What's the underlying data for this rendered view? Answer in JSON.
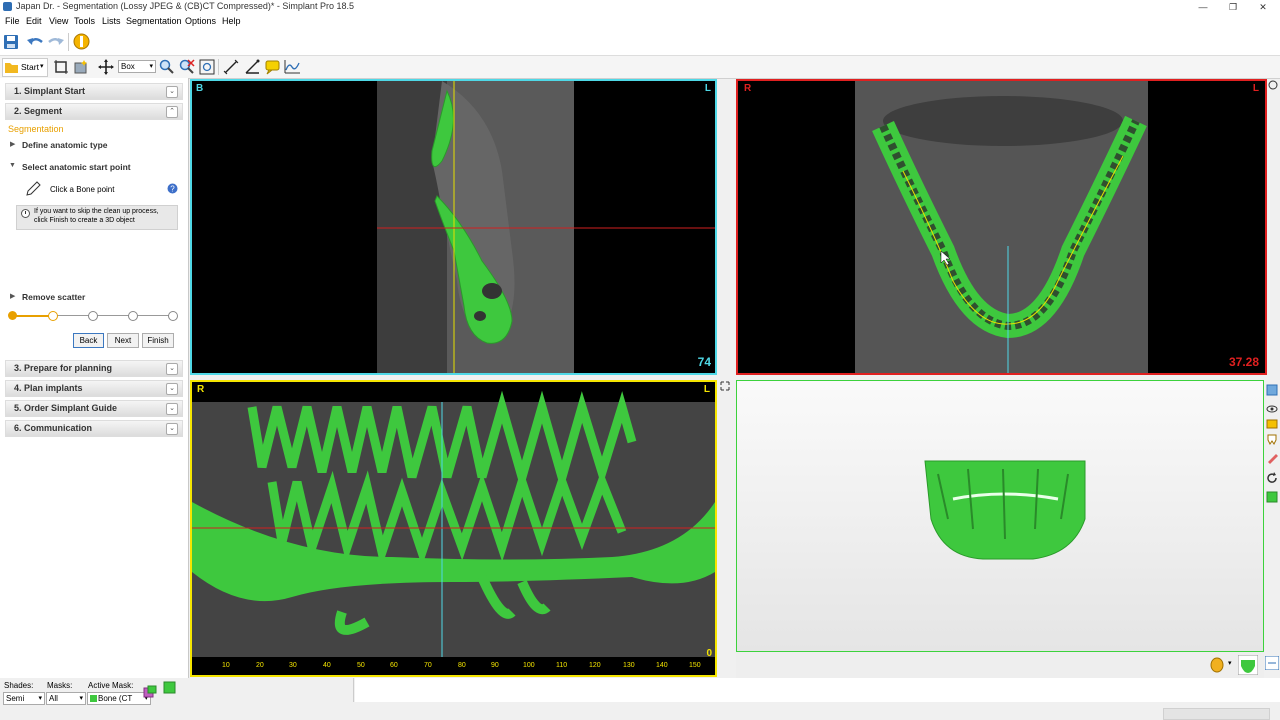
{
  "window": {
    "title": "Japan Dr. - Segmentation (Lossy JPEG & (CB)CT Compressed)* - Simplant Pro 18.5",
    "buttons": [
      "—",
      "❐",
      "✕"
    ]
  },
  "menu": [
    "File",
    "Edit",
    "View",
    "Tools",
    "Lists",
    "Segmentation",
    "Options",
    "Help"
  ],
  "toolbar": {
    "start_label": "Start",
    "box_label": "Box"
  },
  "workflow": {
    "step1": "1. Simplant Start",
    "step2": "2. Segment",
    "segmentation_label": "Segmentation",
    "define_anatomic": "Define anatomic type",
    "select_start_point": "Select anatomic start point",
    "click_bone_point": "Click a Bone point",
    "info_line1": "If you want to skip the clean up process,",
    "info_line2": "click Finish to create a 3D object",
    "remove_scatter": "Remove scatter",
    "progress": {
      "current_step": 1,
      "total_steps": 5
    },
    "back_label": "Back",
    "next_label": "Next",
    "finish_label": "Finish",
    "step3": "3. Prepare for planning",
    "step4": "4. Plan implants",
    "step5": "5. Order Simplant Guide",
    "step6": "6. Communication"
  },
  "views": {
    "axial_sagittal": {
      "tl": "B",
      "tr": "L",
      "value": "74",
      "border": "#4fd8e6"
    },
    "axial": {
      "tl": "R",
      "tr": "L",
      "value": "37.28",
      "border": "#e02020"
    },
    "panoramic": {
      "tl": "R",
      "tr": "L",
      "value": "0",
      "border": "#f5e500",
      "ruler": [
        "10",
        "20",
        "30",
        "40",
        "50",
        "60",
        "70",
        "80",
        "90",
        "100",
        "110",
        "120",
        "130",
        "140",
        "150"
      ]
    },
    "3d": {
      "border": "#3cd23c"
    }
  },
  "status": {
    "shades_label": "Shades:",
    "shades_value": "Semi",
    "masks_label": "Masks:",
    "masks_value": "All",
    "active_mask_label": "Active Mask:",
    "active_mask_value": "Bone (CT"
  },
  "colors": {
    "bone_green": "#3ec83e",
    "accent_orange": "#e8a000"
  }
}
